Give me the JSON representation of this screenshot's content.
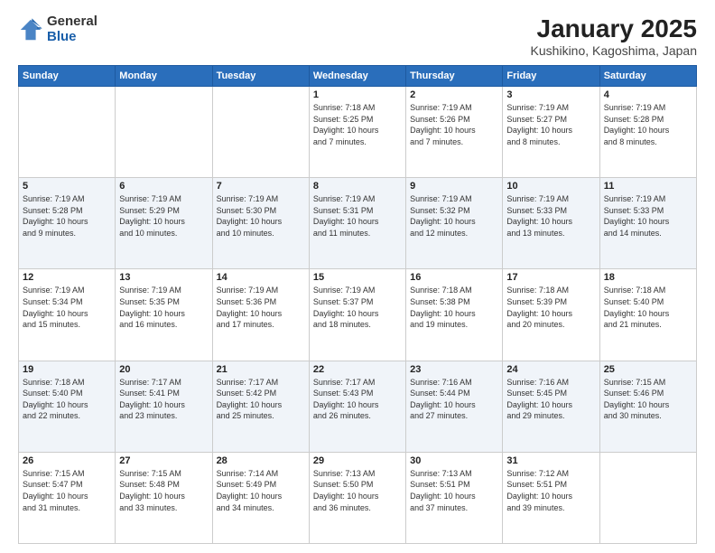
{
  "logo": {
    "general": "General",
    "blue": "Blue"
  },
  "title": "January 2025",
  "subtitle": "Kushikino, Kagoshima, Japan",
  "days_of_week": [
    "Sunday",
    "Monday",
    "Tuesday",
    "Wednesday",
    "Thursday",
    "Friday",
    "Saturday"
  ],
  "weeks": [
    [
      {
        "day": "",
        "info": ""
      },
      {
        "day": "",
        "info": ""
      },
      {
        "day": "",
        "info": ""
      },
      {
        "day": "1",
        "info": "Sunrise: 7:18 AM\nSunset: 5:25 PM\nDaylight: 10 hours\nand 7 minutes."
      },
      {
        "day": "2",
        "info": "Sunrise: 7:19 AM\nSunset: 5:26 PM\nDaylight: 10 hours\nand 7 minutes."
      },
      {
        "day": "3",
        "info": "Sunrise: 7:19 AM\nSunset: 5:27 PM\nDaylight: 10 hours\nand 8 minutes."
      },
      {
        "day": "4",
        "info": "Sunrise: 7:19 AM\nSunset: 5:28 PM\nDaylight: 10 hours\nand 8 minutes."
      }
    ],
    [
      {
        "day": "5",
        "info": "Sunrise: 7:19 AM\nSunset: 5:28 PM\nDaylight: 10 hours\nand 9 minutes."
      },
      {
        "day": "6",
        "info": "Sunrise: 7:19 AM\nSunset: 5:29 PM\nDaylight: 10 hours\nand 10 minutes."
      },
      {
        "day": "7",
        "info": "Sunrise: 7:19 AM\nSunset: 5:30 PM\nDaylight: 10 hours\nand 10 minutes."
      },
      {
        "day": "8",
        "info": "Sunrise: 7:19 AM\nSunset: 5:31 PM\nDaylight: 10 hours\nand 11 minutes."
      },
      {
        "day": "9",
        "info": "Sunrise: 7:19 AM\nSunset: 5:32 PM\nDaylight: 10 hours\nand 12 minutes."
      },
      {
        "day": "10",
        "info": "Sunrise: 7:19 AM\nSunset: 5:33 PM\nDaylight: 10 hours\nand 13 minutes."
      },
      {
        "day": "11",
        "info": "Sunrise: 7:19 AM\nSunset: 5:33 PM\nDaylight: 10 hours\nand 14 minutes."
      }
    ],
    [
      {
        "day": "12",
        "info": "Sunrise: 7:19 AM\nSunset: 5:34 PM\nDaylight: 10 hours\nand 15 minutes."
      },
      {
        "day": "13",
        "info": "Sunrise: 7:19 AM\nSunset: 5:35 PM\nDaylight: 10 hours\nand 16 minutes."
      },
      {
        "day": "14",
        "info": "Sunrise: 7:19 AM\nSunset: 5:36 PM\nDaylight: 10 hours\nand 17 minutes."
      },
      {
        "day": "15",
        "info": "Sunrise: 7:19 AM\nSunset: 5:37 PM\nDaylight: 10 hours\nand 18 minutes."
      },
      {
        "day": "16",
        "info": "Sunrise: 7:18 AM\nSunset: 5:38 PM\nDaylight: 10 hours\nand 19 minutes."
      },
      {
        "day": "17",
        "info": "Sunrise: 7:18 AM\nSunset: 5:39 PM\nDaylight: 10 hours\nand 20 minutes."
      },
      {
        "day": "18",
        "info": "Sunrise: 7:18 AM\nSunset: 5:40 PM\nDaylight: 10 hours\nand 21 minutes."
      }
    ],
    [
      {
        "day": "19",
        "info": "Sunrise: 7:18 AM\nSunset: 5:40 PM\nDaylight: 10 hours\nand 22 minutes."
      },
      {
        "day": "20",
        "info": "Sunrise: 7:17 AM\nSunset: 5:41 PM\nDaylight: 10 hours\nand 23 minutes."
      },
      {
        "day": "21",
        "info": "Sunrise: 7:17 AM\nSunset: 5:42 PM\nDaylight: 10 hours\nand 25 minutes."
      },
      {
        "day": "22",
        "info": "Sunrise: 7:17 AM\nSunset: 5:43 PM\nDaylight: 10 hours\nand 26 minutes."
      },
      {
        "day": "23",
        "info": "Sunrise: 7:16 AM\nSunset: 5:44 PM\nDaylight: 10 hours\nand 27 minutes."
      },
      {
        "day": "24",
        "info": "Sunrise: 7:16 AM\nSunset: 5:45 PM\nDaylight: 10 hours\nand 29 minutes."
      },
      {
        "day": "25",
        "info": "Sunrise: 7:15 AM\nSunset: 5:46 PM\nDaylight: 10 hours\nand 30 minutes."
      }
    ],
    [
      {
        "day": "26",
        "info": "Sunrise: 7:15 AM\nSunset: 5:47 PM\nDaylight: 10 hours\nand 31 minutes."
      },
      {
        "day": "27",
        "info": "Sunrise: 7:15 AM\nSunset: 5:48 PM\nDaylight: 10 hours\nand 33 minutes."
      },
      {
        "day": "28",
        "info": "Sunrise: 7:14 AM\nSunset: 5:49 PM\nDaylight: 10 hours\nand 34 minutes."
      },
      {
        "day": "29",
        "info": "Sunrise: 7:13 AM\nSunset: 5:50 PM\nDaylight: 10 hours\nand 36 minutes."
      },
      {
        "day": "30",
        "info": "Sunrise: 7:13 AM\nSunset: 5:51 PM\nDaylight: 10 hours\nand 37 minutes."
      },
      {
        "day": "31",
        "info": "Sunrise: 7:12 AM\nSunset: 5:51 PM\nDaylight: 10 hours\nand 39 minutes."
      },
      {
        "day": "",
        "info": ""
      }
    ]
  ]
}
